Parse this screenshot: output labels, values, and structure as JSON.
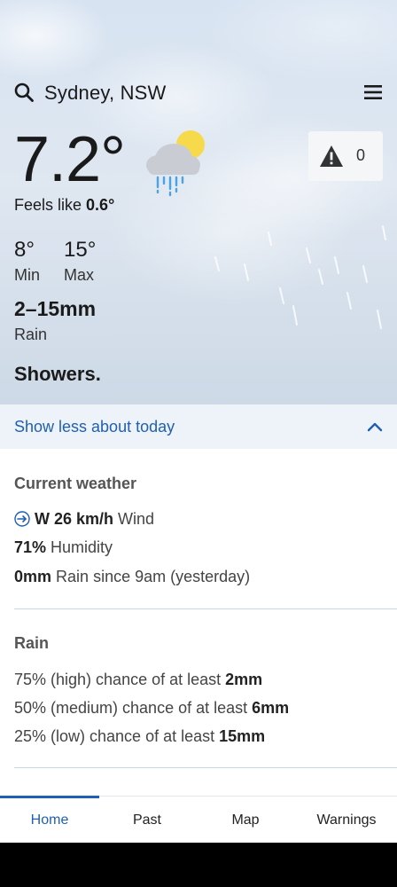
{
  "header": {
    "location": "Sydney, NSW"
  },
  "current": {
    "temp": "7.2°",
    "feels_like_label": "Feels like",
    "feels_like_value": "0.6°",
    "min_value": "8°",
    "min_label": "Min",
    "max_value": "15°",
    "max_label": "Max",
    "rain_amount": "2–15mm",
    "rain_label": "Rain",
    "summary": "Showers.",
    "weather_icon": "sun-cloud-rain-icon"
  },
  "warnings": {
    "count": "0",
    "icon": "warning-triangle-icon"
  },
  "toggle": {
    "label": "Show less about today"
  },
  "current_weather": {
    "title": "Current weather",
    "wind_value": "W 26 km/h",
    "wind_label": "Wind",
    "humidity_value": "71%",
    "humidity_label": "Humidity",
    "rain_value": "0mm",
    "rain_label": "Rain since 9am (yesterday)"
  },
  "rain": {
    "title": "Rain",
    "rows": [
      {
        "prefix": "75% (high) chance of at least",
        "value": "2mm"
      },
      {
        "prefix": "50% (medium) chance of at least",
        "value": "6mm"
      },
      {
        "prefix": "25% (low) chance of at least",
        "value": "15mm"
      }
    ]
  },
  "tabs": [
    {
      "label": "Home",
      "active": true
    },
    {
      "label": "Past",
      "active": false
    },
    {
      "label": "Map",
      "active": false
    },
    {
      "label": "Warnings",
      "active": false
    }
  ],
  "colors": {
    "accent": "#1f5fb4",
    "toggle_bg": "#eef3fa"
  }
}
